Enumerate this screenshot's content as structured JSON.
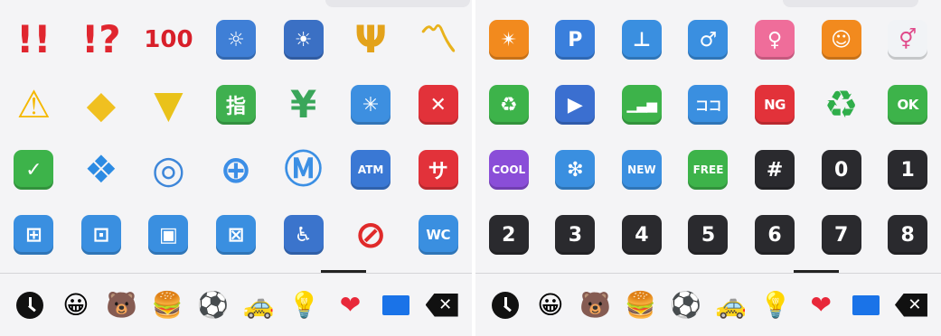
{
  "left_panel": {
    "rows": [
      [
        {
          "icon": "double-exclamation-icon",
          "kind": "plain",
          "text": "!!",
          "color": "#e0262f"
        },
        {
          "icon": "exclamation-question-icon",
          "kind": "plain",
          "text": "!?",
          "color": "#e0262f"
        },
        {
          "icon": "hundred-points-icon",
          "kind": "plain",
          "text": "100",
          "color": "#d81f2a"
        },
        {
          "icon": "dim-button-icon",
          "kind": "tile",
          "text": "☼",
          "bg": "#3f7fd6"
        },
        {
          "icon": "bright-button-icon",
          "kind": "tile",
          "text": "☀",
          "bg": "#3b70c4"
        },
        {
          "icon": "trident-emblem-icon",
          "kind": "plain",
          "text": "Ψ",
          "color": "#e3a21a"
        },
        {
          "icon": "part-alternation-mark-icon",
          "kind": "plain",
          "text": "〽",
          "color": "#e8b21c"
        }
      ],
      [
        {
          "icon": "warning-icon",
          "kind": "plain",
          "text": "⚠",
          "color": "#f5b800"
        },
        {
          "icon": "children-crossing-icon",
          "kind": "plain",
          "text": "◆",
          "color": "#f0c020"
        },
        {
          "icon": "japanese-beginner-icon",
          "kind": "plain",
          "text": "▼",
          "color": "#e9c21a"
        },
        {
          "icon": "japanese-reserved-button-icon",
          "kind": "tile",
          "text": "指",
          "bg": "#3fb04f"
        },
        {
          "icon": "chart-increasing-yen-icon",
          "kind": "plain",
          "text": "¥",
          "color": "#3aa65a"
        },
        {
          "icon": "eight-spoked-asterisk-icon",
          "kind": "tile",
          "text": "✳",
          "bg": "#3d8fe0"
        },
        {
          "icon": "cross-mark-button-icon",
          "kind": "tile",
          "text": "✕",
          "bg": "#e2323a"
        }
      ],
      [
        {
          "icon": "check-mark-button-icon",
          "kind": "tile",
          "text": "✓",
          "bg": "#3db34a"
        },
        {
          "icon": "diamond-with-dot-icon",
          "kind": "plain",
          "text": "❖",
          "color": "#2c8be3"
        },
        {
          "icon": "cyclone-icon",
          "kind": "plain",
          "text": "◎",
          "color": "#3d86d9"
        },
        {
          "icon": "globe-with-meridians-icon",
          "kind": "plain",
          "text": "⊕",
          "color": "#3c8ee6"
        },
        {
          "icon": "circled-m-icon",
          "kind": "plain",
          "text": "Ⓜ",
          "color": "#3b8fe4"
        },
        {
          "icon": "atm-sign-icon",
          "kind": "tile",
          "text": "ATM",
          "bg": "#3a78d4",
          "size": "tiny"
        },
        {
          "icon": "japanese-service-charge-button-icon",
          "kind": "tile",
          "text": "サ",
          "bg": "#e2323a"
        }
      ],
      [
        {
          "icon": "passport-control-icon",
          "kind": "tile",
          "text": "⊞",
          "bg": "#3a8fe0"
        },
        {
          "icon": "customs-icon",
          "kind": "tile",
          "text": "⊡",
          "bg": "#3a8fe0"
        },
        {
          "icon": "baggage-claim-icon",
          "kind": "tile",
          "text": "▣",
          "bg": "#3a8fe0"
        },
        {
          "icon": "left-luggage-icon",
          "kind": "tile",
          "text": "⊠",
          "bg": "#3a8fe0"
        },
        {
          "icon": "wheelchair-symbol-icon",
          "kind": "tile",
          "text": "♿",
          "bg": "#3b74cc"
        },
        {
          "icon": "no-smoking-icon",
          "kind": "plain",
          "text": "⊘",
          "color": "#e02a2a"
        },
        {
          "icon": "water-closet-icon",
          "kind": "tile",
          "text": "WC",
          "bg": "#3a8fe0",
          "size": "small"
        }
      ]
    ]
  },
  "right_panel": {
    "rows": [
      [
        {
          "icon": "eight-pointed-star-icon",
          "kind": "tile",
          "text": "✴",
          "bg": "#f28a1e"
        },
        {
          "icon": "p-button-icon",
          "kind": "tile",
          "text": "P",
          "bg": "#3a7fdc"
        },
        {
          "icon": "potable-water-icon",
          "kind": "tile",
          "text": "⊥",
          "bg": "#3a8fe0"
        },
        {
          "icon": "mens-room-icon",
          "kind": "tile",
          "text": "♂",
          "bg": "#3a8fe0"
        },
        {
          "icon": "womens-room-icon",
          "kind": "tile",
          "text": "♀",
          "bg": "#ef6d9a"
        },
        {
          "icon": "baby-symbol-icon",
          "kind": "tile",
          "text": "☺",
          "bg": "#f28a1e"
        },
        {
          "icon": "restroom-icon",
          "kind": "tile",
          "text": "⚥",
          "bg": "#f1f3f6",
          "fg": "#e04a8a"
        }
      ],
      [
        {
          "icon": "litter-in-bin-sign-icon",
          "kind": "tile",
          "text": "♻",
          "bg": "#3db34a"
        },
        {
          "icon": "cinema-icon",
          "kind": "tile",
          "text": "▶",
          "bg": "#3b6fd0"
        },
        {
          "icon": "antenna-bars-icon",
          "kind": "tile",
          "text": "▁▃▅",
          "bg": "#3db34a",
          "size": "small"
        },
        {
          "icon": "japanese-here-button-icon",
          "kind": "tile",
          "text": "ココ",
          "bg": "#3a8fe0",
          "size": "small"
        },
        {
          "icon": "ng-button-icon",
          "kind": "tile",
          "text": "NG",
          "bg": "#e2323a",
          "size": "small"
        },
        {
          "icon": "recycling-symbol-icon",
          "kind": "plain",
          "text": "♻",
          "color": "#2fae4a"
        },
        {
          "icon": "ok-button-icon",
          "kind": "tile",
          "text": "OK",
          "bg": "#3db34a",
          "size": "small"
        }
      ],
      [
        {
          "icon": "cool-button-icon",
          "kind": "tile",
          "text": "COOL",
          "bg": "#8a4ed8",
          "size": "tiny"
        },
        {
          "icon": "sparkle-icon",
          "kind": "tile",
          "text": "❇",
          "bg": "#3a8fe0"
        },
        {
          "icon": "new-button-icon",
          "kind": "tile",
          "text": "NEW",
          "bg": "#3a8fe0",
          "size": "tiny"
        },
        {
          "icon": "free-button-icon",
          "kind": "tile",
          "text": "FREE",
          "bg": "#3db34a",
          "size": "tiny"
        },
        {
          "icon": "keycap-hash-icon",
          "kind": "tile",
          "text": "#",
          "bg": "#2a2a2e"
        },
        {
          "icon": "keycap-0-icon",
          "kind": "tile",
          "text": "0",
          "bg": "#2a2a2e"
        },
        {
          "icon": "keycap-1-icon",
          "kind": "tile",
          "text": "1",
          "bg": "#2a2a2e"
        }
      ],
      [
        {
          "icon": "keycap-2-icon",
          "kind": "tile",
          "text": "2",
          "bg": "#2a2a2e"
        },
        {
          "icon": "keycap-3-icon",
          "kind": "tile",
          "text": "3",
          "bg": "#2a2a2e"
        },
        {
          "icon": "keycap-4-icon",
          "kind": "tile",
          "text": "4",
          "bg": "#2a2a2e"
        },
        {
          "icon": "keycap-5-icon",
          "kind": "tile",
          "text": "5",
          "bg": "#2a2a2e"
        },
        {
          "icon": "keycap-6-icon",
          "kind": "tile",
          "text": "6",
          "bg": "#2a2a2e"
        },
        {
          "icon": "keycap-7-icon",
          "kind": "tile",
          "text": "7",
          "bg": "#2a2a2e"
        },
        {
          "icon": "keycap-8-icon",
          "kind": "tile",
          "text": "8",
          "bg": "#2a2a2e"
        }
      ]
    ]
  },
  "toolbar": {
    "categories": [
      {
        "icon": "recent-clock-icon",
        "glyph": ""
      },
      {
        "icon": "smileys-category-icon",
        "glyph": "😀"
      },
      {
        "icon": "animals-category-icon",
        "glyph": "🐻"
      },
      {
        "icon": "food-category-icon",
        "glyph": "🍔"
      },
      {
        "icon": "activity-category-icon",
        "glyph": "⚽"
      },
      {
        "icon": "travel-category-icon",
        "glyph": "🚕"
      },
      {
        "icon": "objects-category-icon",
        "glyph": "💡"
      },
      {
        "icon": "symbols-category-icon",
        "glyph": "❤",
        "color": "#e8283a"
      },
      {
        "icon": "flags-category-icon",
        "glyph": ""
      },
      {
        "icon": "backspace-icon",
        "glyph": "✕"
      }
    ]
  }
}
